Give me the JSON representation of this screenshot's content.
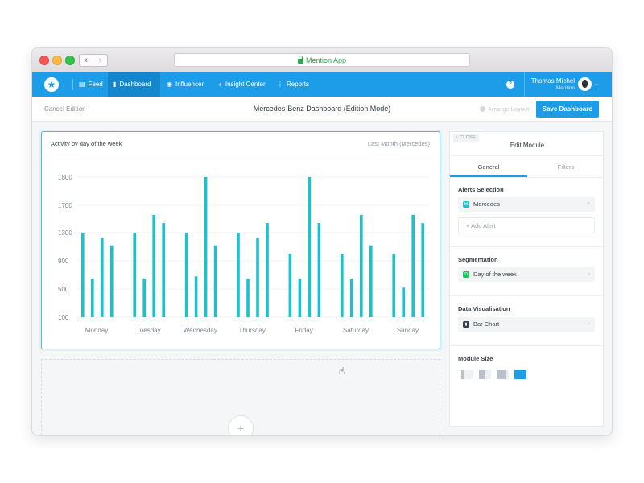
{
  "browser": {
    "url_text": "Mention App",
    "back_glyph": "‹",
    "forward_glyph": "›"
  },
  "nav": {
    "logo_glyph": "★",
    "items": [
      {
        "label": "Feed",
        "icon": "feed-icon",
        "glyph": "▤"
      },
      {
        "label": "Dashboard",
        "icon": "dashboard-icon",
        "glyph": "▮",
        "active": true
      },
      {
        "label": "Influencer",
        "icon": "influencer-icon",
        "glyph": "◉"
      },
      {
        "label": "Insight Center",
        "icon": "insight-icon",
        "glyph": "◕"
      },
      {
        "label": "Reports",
        "icon": "reports-icon",
        "glyph": "⋮"
      }
    ],
    "help_glyph": "?",
    "user_name": "Thomas Michel",
    "user_org": "Mention",
    "chevron_glyph": "⌄"
  },
  "subheader": {
    "cancel_label": "Cancel Edition",
    "title": "Mercedes-Benz Dashboard (Edition Mode)",
    "arrange_label": "Arrange Layout",
    "save_label": "Save Dashboard"
  },
  "widget": {
    "title": "Activity by day of the week",
    "range_label": "Last Month (Mercedes)"
  },
  "chart_data": {
    "type": "bar",
    "categories": [
      "Monday",
      "Tuesday",
      "Wednesday",
      "Thursday",
      "Friday",
      "Saturday",
      "Sunday"
    ],
    "y_ticks": [
      100,
      500,
      900,
      1300,
      1700,
      1800
    ],
    "tick_labels": [
      "100",
      "500",
      "900",
      "1300",
      "1700",
      "1800"
    ],
    "ylim": [
      100,
      1800
    ],
    "bar_color": "#19c3cc",
    "grid": true,
    "series": [
      {
        "values": [
          1300,
          1300,
          1300,
          1300,
          1000,
          1000,
          1000
        ]
      },
      {
        "values": [
          650,
          650,
          680,
          650,
          650,
          650,
          520
        ]
      },
      {
        "values": [
          1220,
          1560,
          1800,
          1220,
          1800,
          1560,
          1560
        ]
      },
      {
        "values": [
          1120,
          1440,
          1120,
          1440,
          1440,
          1120,
          1440
        ]
      }
    ]
  },
  "dropzone": {
    "add_glyph": "+",
    "cursor_glyph": "☝"
  },
  "panel": {
    "close_label": "‹ CLOSE",
    "title": "Edit Module",
    "tabs": [
      "General",
      "Filters"
    ],
    "alerts_label": "Alerts Selection",
    "alert_chip": "Mercedes",
    "alert_chip_badge": "M",
    "alert_remove_glyph": "×",
    "add_alert": "+   Add Alert",
    "segmentation_label": "Segmentation",
    "segmentation_value": "Day of the week",
    "segmentation_badge": "D",
    "visualisation_label": "Data Visualisation",
    "visualisation_value": "Bar Chart",
    "visualisation_badge": "▮",
    "chevron_right": "›",
    "size_label": "Module Size",
    "size_selected_index": 3
  },
  "colors": {
    "accent": "#1d9de8",
    "bar": "#19c3cc",
    "alert_badge": "#1fc5c9",
    "segmentation_badge": "#25c35a",
    "visualisation_badge": "#37424e"
  }
}
